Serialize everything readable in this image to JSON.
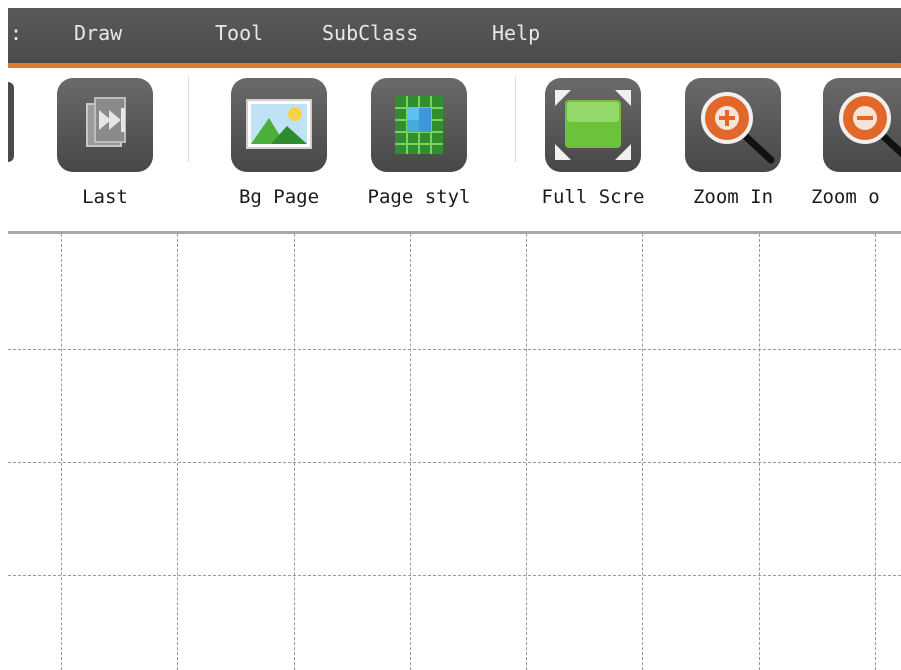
{
  "menubar": {
    "fragment": ":",
    "items": [
      {
        "label": "Draw"
      },
      {
        "label": "Tool"
      },
      {
        "label": "SubClass"
      },
      {
        "label": "Help"
      }
    ]
  },
  "toolbar": {
    "tools": [
      {
        "label": "Last",
        "icon": "last-page-icon"
      },
      {
        "label": "Bg Page",
        "icon": "background-image-icon"
      },
      {
        "label": "Page styl",
        "icon": "page-style-grid-icon"
      },
      {
        "label": "Full Scre",
        "icon": "fullscreen-icon"
      },
      {
        "label": "Zoom In",
        "icon": "zoom-in-icon"
      },
      {
        "label": "Zoom o",
        "icon": "zoom-out-icon"
      }
    ]
  },
  "colors": {
    "menubar_bg": "#4f4f4f",
    "accent_line": "#e07a2a",
    "icon_tile": "#555555",
    "grid_line": "#9a9a9a"
  }
}
